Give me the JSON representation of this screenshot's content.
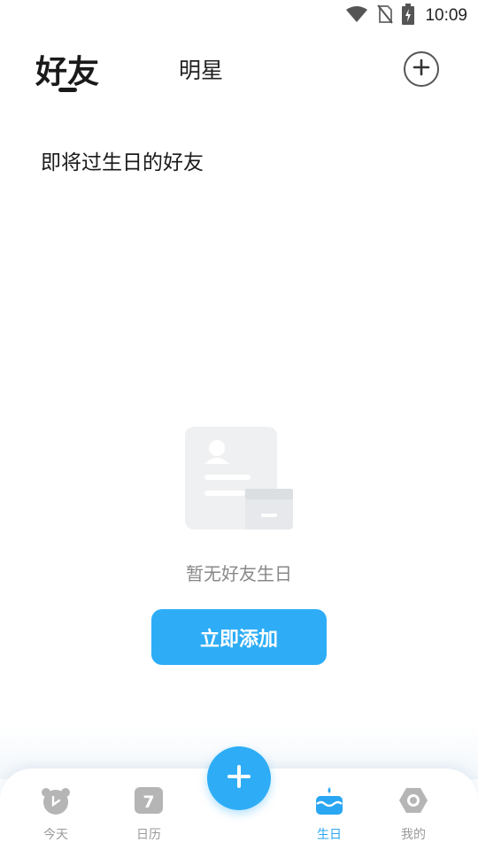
{
  "status_bar": {
    "time": "10:09",
    "icons": [
      "wifi-icon",
      "no-sim-icon",
      "battery-charging-icon"
    ]
  },
  "header": {
    "tabs": [
      {
        "label": "好友",
        "active": true
      },
      {
        "label": "明星",
        "active": false
      }
    ],
    "add_icon": "plus-circle-icon"
  },
  "section": {
    "title": "即将过生日的好友"
  },
  "empty_state": {
    "illustration": "empty-contact-card-icon",
    "message": "暂无好友生日",
    "button_label": "立即添加"
  },
  "bottom_nav": {
    "items": [
      {
        "label": "今天",
        "icon": "bear-clock-icon",
        "active": false
      },
      {
        "label": "日历",
        "icon": "calendar-7-icon",
        "active": false
      },
      {
        "label": "生日",
        "icon": "birthday-cake-icon",
        "active": true
      },
      {
        "label": "我的",
        "icon": "profile-gear-icon",
        "active": false
      }
    ],
    "fab_icon": "plus-icon"
  },
  "colors": {
    "accent": "#2eadf6",
    "active_nav": "#2aa6f2",
    "inactive_nav": "#9a9a9a",
    "placeholder_text": "#888888"
  }
}
